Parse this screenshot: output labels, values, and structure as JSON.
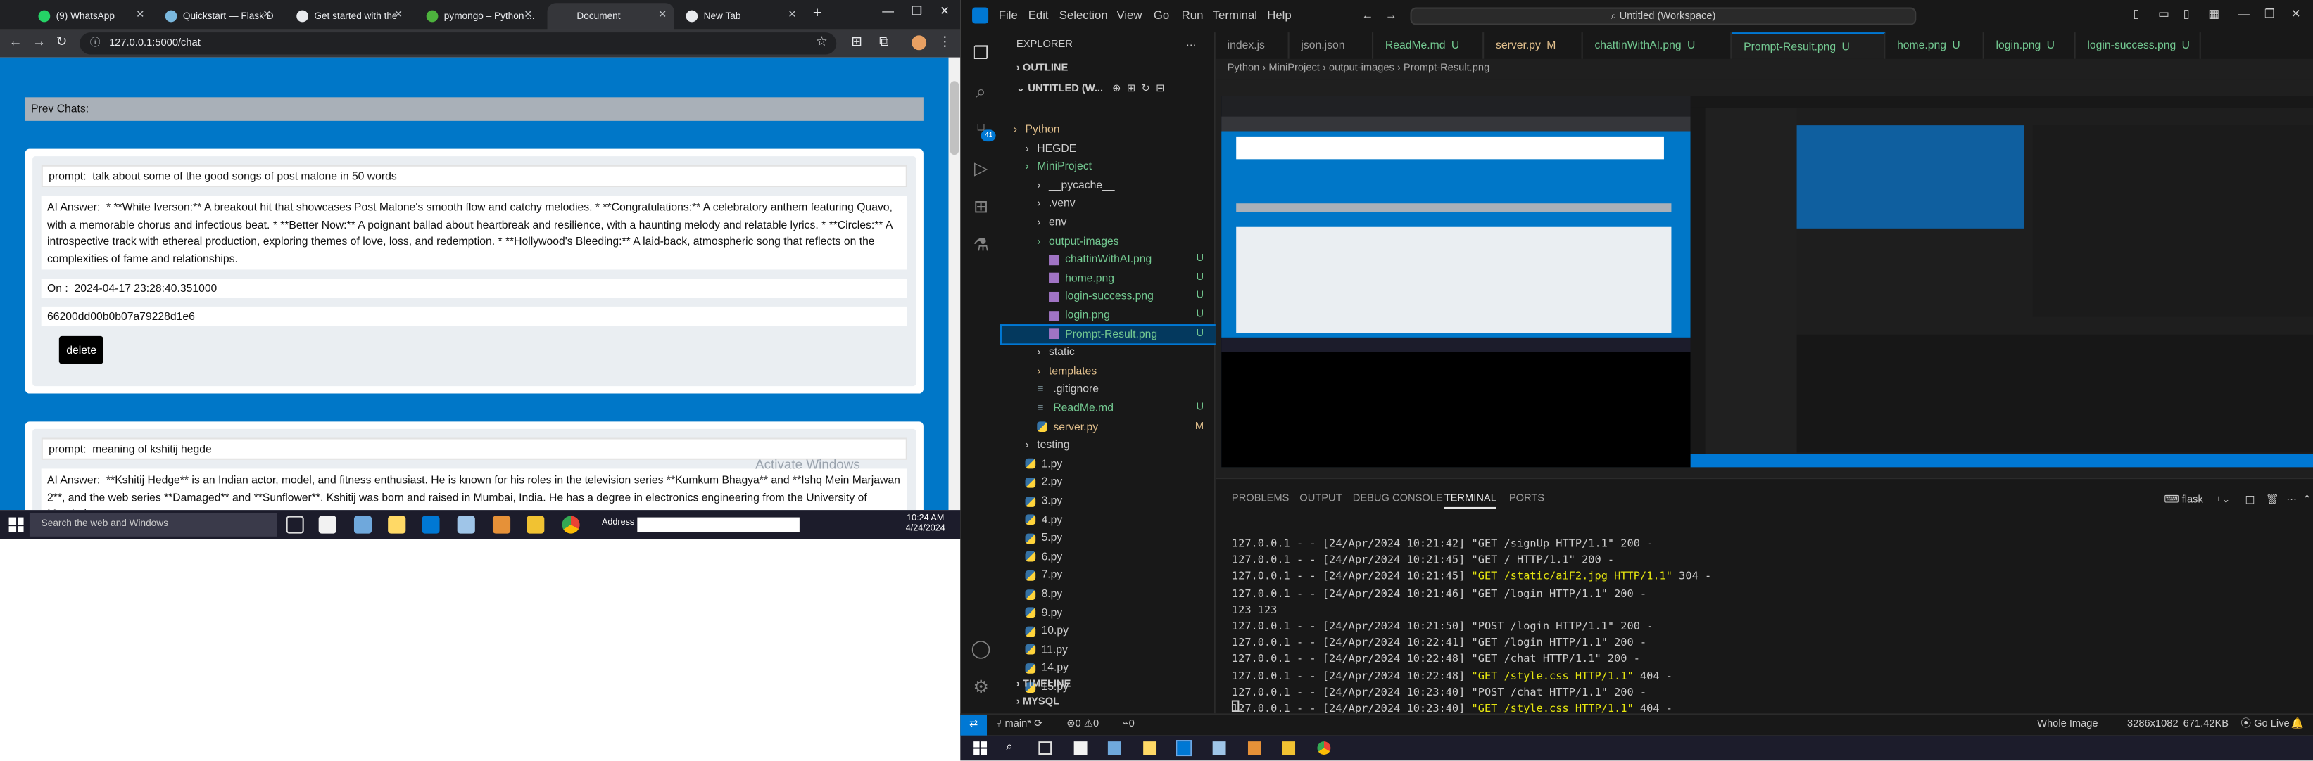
{
  "browser": {
    "tabs": [
      {
        "label": "(9) WhatsApp",
        "color": "#25d366"
      },
      {
        "label": "Quickstart — Flask D",
        "color": "#7ab8de"
      },
      {
        "label": "Get started with the",
        "color": "#e8eaed"
      },
      {
        "label": "pymongo – Python ...",
        "color": "#4db33d"
      },
      {
        "label": "Document",
        "color": "#e8eaed"
      },
      {
        "label": "New Tab",
        "color": "#e8eaed"
      }
    ],
    "url": "127.0.0.1:5000/chat",
    "prev_chats_label": "Prev Chats:",
    "chats": [
      {
        "prompt_label": "prompt:",
        "prompt": "talk about some of the good songs of post malone in 50 words",
        "answer_label": "AI Answer:",
        "answer": "* **White Iverson:** A breakout hit that showcases Post Malone's smooth flow and catchy melodies. * **Congratulations:** A celebratory anthem featuring Quavo, with a memorable chorus and infectious beat. * **Better Now:** A poignant ballad about heartbreak and resilience, with a haunting melody and relatable lyrics. * **Circles:** A introspective track with ethereal production, exploring themes of love, loss, and redemption. * **Hollywood's Bleeding:** A laid-back, atmospheric song that reflects on the complexities of fame and relationships.",
        "on_label": "On :",
        "on": "2024-04-17 23:28:40.351000",
        "id": "66200dd00b0b07a79228d1e6",
        "delete_label": "delete"
      },
      {
        "prompt_label": "prompt:",
        "prompt": "meaning of kshitij hegde",
        "answer_label": "AI Answer:",
        "answer": "**Kshitij Hedge** is an Indian actor, model, and fitness enthusiast. He is known for his roles in the television series **Kumkum Bhagya** and **Ishq Mein Marjawan 2**, and the web series **Damaged** and **Sunflower**. Kshitij was born and raised in Mumbai, India. He has a degree in electronics engineering from the University of Mumbai."
      }
    ],
    "watermark": "Activate Windows"
  },
  "win_taskbar": {
    "search_placeholder": "Search the web and Windows",
    "address_label": "Address",
    "time": "10:24 AM",
    "date": "4/24/2024"
  },
  "vscode": {
    "menu": [
      "File",
      "Edit",
      "Selection",
      "View",
      "Go",
      "Run",
      "Terminal",
      "Help"
    ],
    "command_center": "Untitled (Workspace)",
    "explorer_title": "EXPLORER",
    "outline": "OUTLINE",
    "workspace": "UNTITLED (W...",
    "timeline": "TIMELINE",
    "mysql": "MYSQL",
    "tree": [
      {
        "label": "Python",
        "indent": 0,
        "kind": "folder",
        "color": "mod"
      },
      {
        "label": "HEGDE",
        "indent": 1,
        "kind": "folder",
        "color": ""
      },
      {
        "label": "MiniProject",
        "indent": 1,
        "kind": "folder",
        "color": "git"
      },
      {
        "label": "__pycache__",
        "indent": 2,
        "kind": "folder",
        "color": ""
      },
      {
        "label": ".venv",
        "indent": 2,
        "kind": "folder",
        "color": ""
      },
      {
        "label": "env",
        "indent": 2,
        "kind": "folder",
        "color": ""
      },
      {
        "label": "output-images",
        "indent": 2,
        "kind": "folder",
        "color": "git"
      },
      {
        "label": "chattinWithAI.png",
        "indent": 3,
        "kind": "img",
        "color": "git",
        "status": "U"
      },
      {
        "label": "home.png",
        "indent": 3,
        "kind": "img",
        "color": "git",
        "status": "U"
      },
      {
        "label": "login-success.png",
        "indent": 3,
        "kind": "img",
        "color": "git",
        "status": "U"
      },
      {
        "label": "login.png",
        "indent": 3,
        "kind": "img",
        "color": "git",
        "status": "U"
      },
      {
        "label": "Prompt-Result.png",
        "indent": 3,
        "kind": "img",
        "color": "git",
        "status": "U",
        "selected": true
      },
      {
        "label": "static",
        "indent": 2,
        "kind": "folder",
        "color": ""
      },
      {
        "label": "templates",
        "indent": 2,
        "kind": "folder",
        "color": "mod"
      },
      {
        "label": ".gitignore",
        "indent": 2,
        "kind": "file",
        "color": ""
      },
      {
        "label": "ReadMe.md",
        "indent": 2,
        "kind": "file",
        "color": "git",
        "status": "U"
      },
      {
        "label": "server.py",
        "indent": 2,
        "kind": "py",
        "color": "mod",
        "status": "M"
      },
      {
        "label": "testing",
        "indent": 1,
        "kind": "folder",
        "color": ""
      },
      {
        "label": "1.py",
        "indent": 1,
        "kind": "py",
        "color": ""
      },
      {
        "label": "2.py",
        "indent": 1,
        "kind": "py",
        "color": ""
      },
      {
        "label": "3.py",
        "indent": 1,
        "kind": "py",
        "color": ""
      },
      {
        "label": "4.py",
        "indent": 1,
        "kind": "py",
        "color": ""
      },
      {
        "label": "5.py",
        "indent": 1,
        "kind": "py",
        "color": ""
      },
      {
        "label": "6.py",
        "indent": 1,
        "kind": "py",
        "color": ""
      },
      {
        "label": "7.py",
        "indent": 1,
        "kind": "py",
        "color": ""
      },
      {
        "label": "8.py",
        "indent": 1,
        "kind": "py",
        "color": ""
      },
      {
        "label": "9.py",
        "indent": 1,
        "kind": "py",
        "color": ""
      },
      {
        "label": "10.py",
        "indent": 1,
        "kind": "py",
        "color": ""
      },
      {
        "label": "11.py",
        "indent": 1,
        "kind": "py",
        "color": ""
      },
      {
        "label": "14.py",
        "indent": 1,
        "kind": "py",
        "color": ""
      },
      {
        "label": "15.py",
        "indent": 1,
        "kind": "py",
        "color": ""
      }
    ],
    "editor_tabs": [
      {
        "label": "index.js",
        "status": ""
      },
      {
        "label": "json.json",
        "status": ""
      },
      {
        "label": "ReadMe.md",
        "status": "U"
      },
      {
        "label": "server.py",
        "status": "M"
      },
      {
        "label": "chattinWithAI.png",
        "status": "U"
      },
      {
        "label": "Prompt-Result.png",
        "status": "U",
        "active": true
      },
      {
        "label": "home.png",
        "status": "U"
      },
      {
        "label": "login.png",
        "status": "U"
      },
      {
        "label": "login-success.png",
        "status": "U"
      }
    ],
    "breadcrumb": "Python  ›  MiniProject  ›  output-images  ›  Prompt-Result.png",
    "panel_tabs": [
      "PROBLEMS",
      "OUTPUT",
      "DEBUG CONSOLE",
      "TERMINAL",
      "PORTS"
    ],
    "terminal_kind": "flask",
    "terminal_lines": [
      {
        "pre": "127.0.0.1 - - [24/Apr/2024 10:21:42] \"GET /signUp HTTP/1.1\" 200 -",
        "y": ""
      },
      {
        "pre": "127.0.0.1 - - [24/Apr/2024 10:21:45] \"GET / HTTP/1.1\" 200 -",
        "y": ""
      },
      {
        "pre": "127.0.0.1 - - [24/Apr/2024 10:21:45] ",
        "y": "\"GET /static/aiF2.jpg HTTP/1.1\"",
        "post": " 304 -"
      },
      {
        "pre": "127.0.0.1 - - [24/Apr/2024 10:21:46] \"GET /login HTTP/1.1\" 200 -",
        "y": ""
      },
      {
        "pre": "123 123",
        "y": ""
      },
      {
        "pre": "127.0.0.1 - - [24/Apr/2024 10:21:50] \"POST /login HTTP/1.1\" 200 -",
        "y": ""
      },
      {
        "pre": "127.0.0.1 - - [24/Apr/2024 10:22:41] \"GET /login HTTP/1.1\" 200 -",
        "y": ""
      },
      {
        "pre": "127.0.0.1 - - [24/Apr/2024 10:22:48] \"GET /chat HTTP/1.1\" 200 -",
        "y": ""
      },
      {
        "pre": "127.0.0.1 - - [24/Apr/2024 10:22:48] ",
        "y": "\"GET /style.css HTTP/1.1\"",
        "post": " 404 -"
      },
      {
        "pre": "127.0.0.1 - - [24/Apr/2024 10:23:40] \"POST /chat HTTP/1.1\" 200 -",
        "y": ""
      },
      {
        "pre": "127.0.0.1 - - [24/Apr/2024 10:23:40] ",
        "y": "\"GET /style.css HTTP/1.1\"",
        "post": " 404 -"
      }
    ],
    "status": {
      "branch": "main*",
      "errors": "0",
      "warnings": "0",
      "ports": "0",
      "mode": "Whole Image",
      "dims": "3286x1082",
      "size": "671.42KB",
      "golive": "Go Live"
    }
  }
}
